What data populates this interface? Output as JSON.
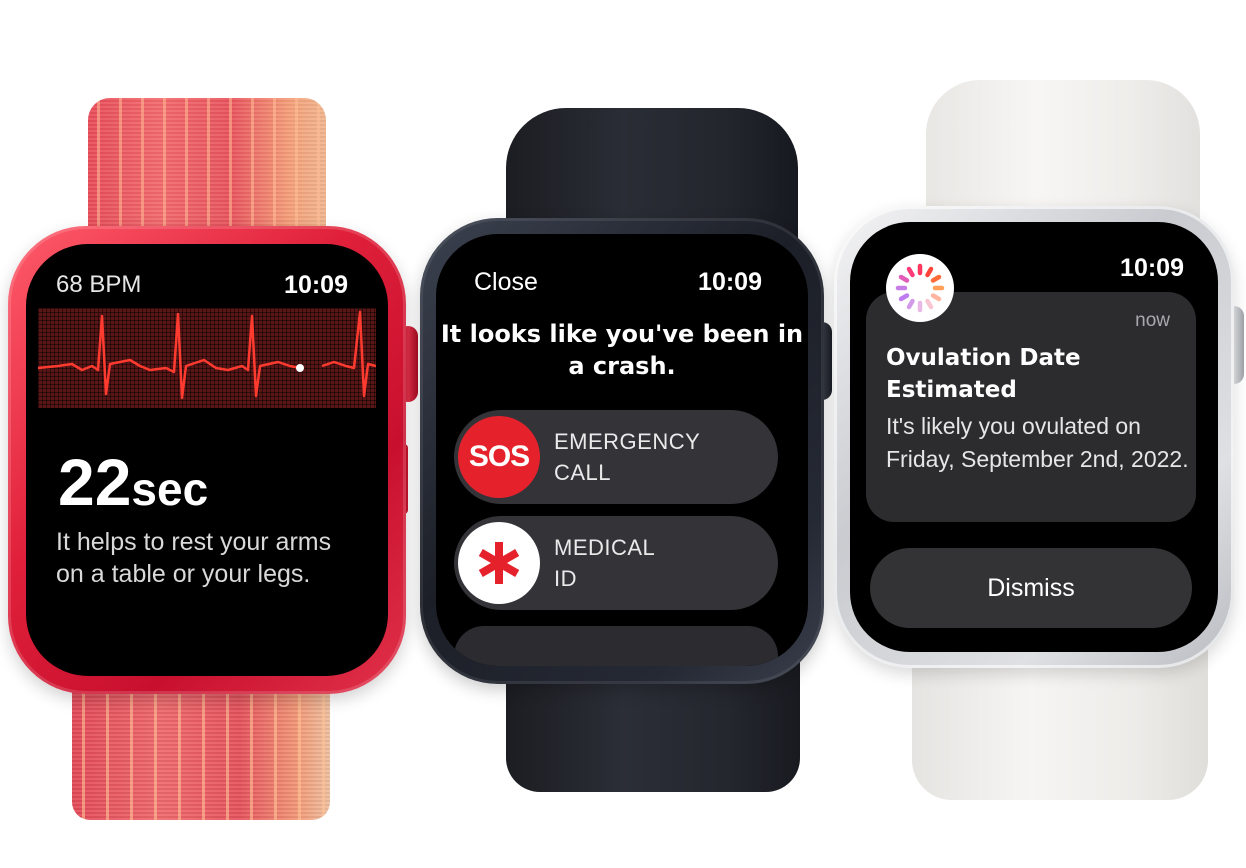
{
  "watch_ecg": {
    "band_color": "#e9545e",
    "case_color": "#d0182f",
    "heart_rate": "68 BPM",
    "time": "10:09",
    "countdown_number": "22",
    "countdown_unit": "sec",
    "message": "It helps to rest your arms on a table or your legs.",
    "trace_color": "#ff3b30"
  },
  "watch_crash": {
    "band_color": "#23262d",
    "case_color": "#1c1f27",
    "close_label": "Close",
    "time": "10:09",
    "title": "It looks like you've been in a crash.",
    "emergency": {
      "badge": "SOS",
      "label": "EMERGENCY CALL",
      "icon": "sos-icon"
    },
    "medical": {
      "label": "MEDICAL ID",
      "icon": "medical-asterisk-icon"
    },
    "accent": "#e5222b"
  },
  "watch_cycle": {
    "band_color": "#f0eeeb",
    "case_color": "#d3d5d9",
    "time": "10:09",
    "app_icon": "cycle-tracking-icon",
    "timestamp": "now",
    "title": "Ovulation Date Estimated",
    "body": "It's likely you ovulated on Friday, September 2nd, 2022.",
    "dismiss_label": "Dismiss"
  }
}
